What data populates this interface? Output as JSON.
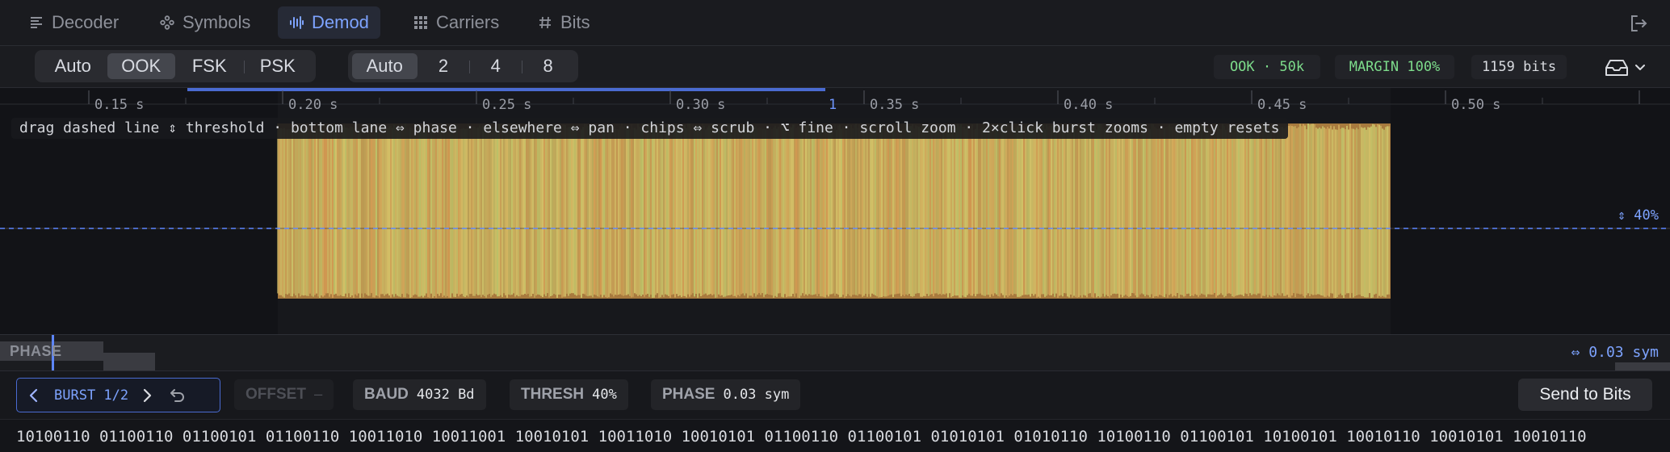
{
  "tabs": [
    {
      "label": "Decoder",
      "icon": "lines-icon"
    },
    {
      "label": "Symbols",
      "icon": "nodes-icon"
    },
    {
      "label": "Demod",
      "icon": "waveform-icon",
      "active": true
    },
    {
      "label": "Carriers",
      "icon": "grid-icon"
    },
    {
      "label": "Bits",
      "icon": "hash-icon"
    }
  ],
  "modulation": {
    "options": [
      "Auto",
      "OOK",
      "FSK",
      "PSK"
    ],
    "selected": "OOK"
  },
  "levels": {
    "options": [
      "Auto",
      "2",
      "4",
      "8"
    ],
    "selected": "Auto"
  },
  "status": {
    "mode": "OOK · 50k",
    "margin": "MARGIN 100%",
    "bits": "1159 bits"
  },
  "timeline": {
    "ticks": [
      "0.15 s",
      "0.20 s",
      "0.25 s",
      "0.30 s",
      "0.35 s",
      "0.40 s",
      "0.45 s",
      "0.50 s"
    ],
    "cursor_label": "1"
  },
  "hint": "drag dashed line ⇕ threshold · bottom lane ⇔ phase · elsewhere ⇔ pan · chips ⇔ scrub · ⌥ fine · scroll zoom · 2×click burst zooms · empty resets",
  "threshold_label": "⇕ 40%",
  "phase_lane": {
    "title": "PHASE",
    "value": "⇔ 0.03 sym"
  },
  "controls": {
    "burst": "BURST 1/2",
    "offset_key": "OFFSET",
    "offset_val": "–",
    "baud_key": "BAUD",
    "baud_val": "4032 Bd",
    "thresh_key": "THRESH",
    "thresh_val": "40%",
    "phase_key": "PHASE",
    "phase_val": "0.03 sym",
    "send": "Send to Bits"
  },
  "bits_text": "10100110 01100110 01100101 01100110 10011010 10011001 10010101 10011010 10010101 01100110 01100101 01010101 01010110 10100110 01100101 10100101 10010110 10010101 10010110",
  "colors": {
    "accent": "#7da3ff",
    "signal": "#f0aa55",
    "ok": "#7ddc8b"
  }
}
